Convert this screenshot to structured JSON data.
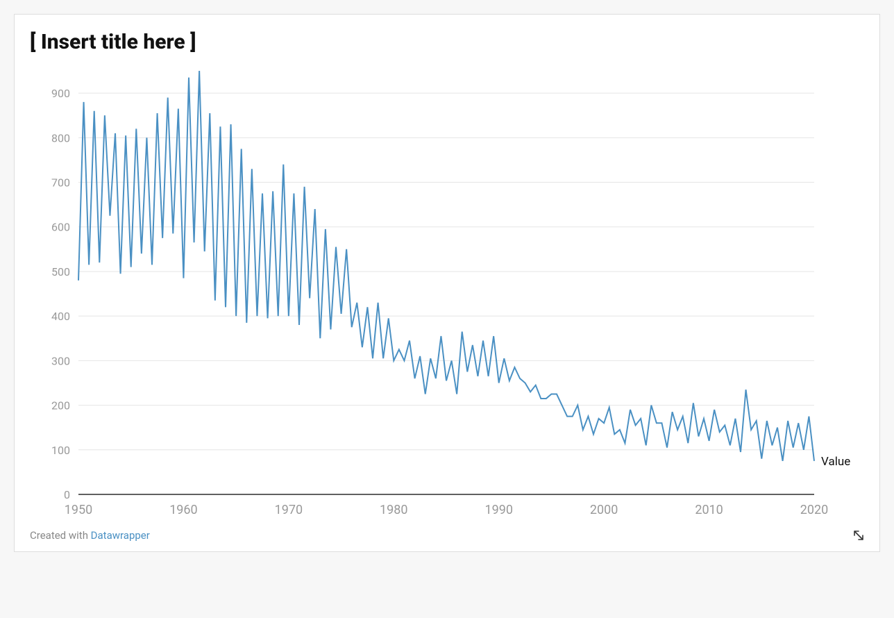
{
  "title": "[ Insert title here ]",
  "footer": {
    "prefix": "Created with ",
    "link_text": "Datawrapper"
  },
  "series_label": "Value",
  "chart_data": {
    "type": "line",
    "title": "[ Insert title here ]",
    "xlabel": "",
    "ylabel": "",
    "xlim": [
      1950,
      2020
    ],
    "ylim": [
      0,
      950
    ],
    "y_ticks": [
      0,
      100,
      200,
      300,
      400,
      500,
      600,
      700,
      800,
      900
    ],
    "x_ticks": [
      1950,
      1960,
      1970,
      1980,
      1990,
      2000,
      2010,
      2020
    ],
    "series": [
      {
        "name": "Value",
        "color": "#4a90c3",
        "x": [
          1950.0,
          1950.5,
          1951.0,
          1951.5,
          1952.0,
          1952.5,
          1953.0,
          1953.5,
          1954.0,
          1954.5,
          1955.0,
          1955.5,
          1956.0,
          1956.5,
          1957.0,
          1957.5,
          1958.0,
          1958.5,
          1959.0,
          1959.5,
          1960.0,
          1960.5,
          1961.0,
          1961.5,
          1962.0,
          1962.5,
          1963.0,
          1963.5,
          1964.0,
          1964.5,
          1965.0,
          1965.5,
          1966.0,
          1966.5,
          1967.0,
          1967.5,
          1968.0,
          1968.5,
          1969.0,
          1969.5,
          1970.0,
          1970.5,
          1971.0,
          1971.5,
          1972.0,
          1972.5,
          1973.0,
          1973.5,
          1974.0,
          1974.5,
          1975.0,
          1975.5,
          1976.0,
          1976.5,
          1977.0,
          1977.5,
          1978.0,
          1978.5,
          1979.0,
          1979.5,
          1980.0,
          1980.5,
          1981.0,
          1981.5,
          1982.0,
          1982.5,
          1983.0,
          1983.5,
          1984.0,
          1984.5,
          1985.0,
          1985.5,
          1986.0,
          1986.5,
          1987.0,
          1987.5,
          1988.0,
          1988.5,
          1989.0,
          1989.5,
          1990.0,
          1990.5,
          1991.0,
          1991.5,
          1992.0,
          1992.5,
          1993.0,
          1993.5,
          1994.0,
          1994.5,
          1995.0,
          1995.5,
          1996.0,
          1996.5,
          1997.0,
          1997.5,
          1998.0,
          1998.5,
          1999.0,
          1999.5,
          2000.0,
          2000.5,
          2001.0,
          2001.5,
          2002.0,
          2002.5,
          2003.0,
          2003.5,
          2004.0,
          2004.5,
          2005.0,
          2005.5,
          2006.0,
          2006.5,
          2007.0,
          2007.5,
          2008.0,
          2008.5,
          2009.0,
          2009.5,
          2010.0,
          2010.5,
          2011.0,
          2011.5,
          2012.0,
          2012.5,
          2013.0,
          2013.5,
          2014.0,
          2014.5,
          2015.0,
          2015.5,
          2016.0,
          2016.5,
          2017.0,
          2017.5,
          2018.0,
          2018.5,
          2019.0,
          2019.5,
          2020.0
        ],
        "values": [
          480,
          880,
          515,
          860,
          520,
          850,
          625,
          810,
          495,
          805,
          510,
          820,
          540,
          800,
          515,
          855,
          575,
          890,
          585,
          865,
          485,
          935,
          565,
          950,
          545,
          855,
          435,
          825,
          420,
          830,
          400,
          775,
          385,
          730,
          400,
          675,
          395,
          680,
          400,
          740,
          400,
          675,
          380,
          690,
          440,
          640,
          350,
          595,
          370,
          555,
          405,
          550,
          375,
          430,
          330,
          420,
          305,
          430,
          305,
          395,
          300,
          325,
          300,
          345,
          260,
          310,
          225,
          305,
          260,
          355,
          255,
          300,
          225,
          365,
          275,
          335,
          265,
          345,
          265,
          355,
          250,
          305,
          255,
          285,
          260,
          250,
          230,
          245,
          215,
          215,
          225,
          225,
          200,
          175,
          175,
          200,
          145,
          175,
          135,
          170,
          160,
          195,
          135,
          145,
          115,
          190,
          155,
          170,
          110,
          200,
          160,
          160,
          105,
          185,
          145,
          175,
          115,
          205,
          130,
          170,
          120,
          190,
          140,
          155,
          110,
          170,
          95,
          235,
          145,
          165,
          80,
          165,
          110,
          150,
          75,
          165,
          105,
          160,
          100,
          175,
          75
        ]
      }
    ]
  }
}
